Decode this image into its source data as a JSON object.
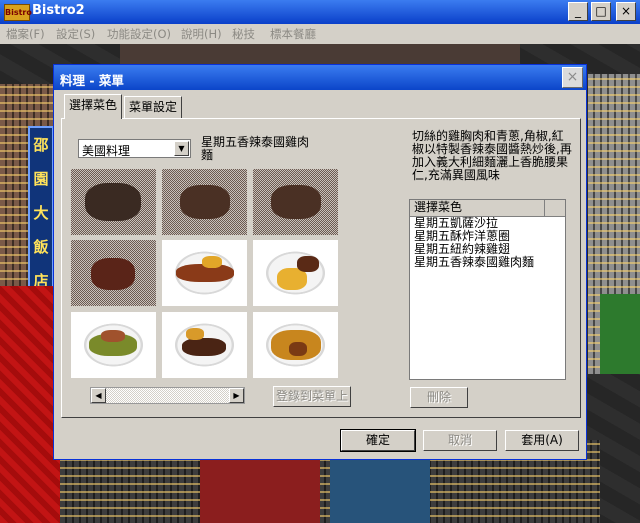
{
  "app": {
    "title": "Bistro2",
    "icon_text": "Bistro",
    "window_buttons": {
      "minimize": "_",
      "maximize": "□",
      "close": "×"
    },
    "menu": [
      "檔案(F)",
      "設定(S)",
      "功能設定(O)",
      "說明(H)",
      "秘技",
      "標本餐廳"
    ]
  },
  "background": {
    "sign_chars": [
      "邵",
      "園",
      "大",
      "飯",
      "店"
    ]
  },
  "dialog": {
    "title": "料理 - 菜單",
    "close_glyph": "×",
    "tabs": [
      {
        "label": "選擇菜色",
        "active": true
      },
      {
        "label": "菜單設定",
        "active": false
      }
    ],
    "category": {
      "selected": "美國料理",
      "arrow": "▼"
    },
    "selected_dish": "星期五香辣泰國雞肉麵",
    "description": "切絲的雞胸肉和青蔥,角椒,紅椒以特製香辣泰國醬熱炒後,再加入義大利細麵灑上香脆腰果仁,充滿異國風味",
    "thumbnails": [
      {
        "name": "dish-1",
        "enabled": false
      },
      {
        "name": "dish-2",
        "enabled": false
      },
      {
        "name": "dish-3",
        "enabled": false
      },
      {
        "name": "dish-4",
        "enabled": false
      },
      {
        "name": "dish-5",
        "enabled": true
      },
      {
        "name": "dish-6",
        "enabled": true
      },
      {
        "name": "dish-7",
        "enabled": true
      },
      {
        "name": "dish-8",
        "enabled": true
      },
      {
        "name": "dish-9",
        "enabled": true
      }
    ],
    "scrollbar": {
      "left_arrow": "◀",
      "right_arrow": "▶"
    },
    "add_to_menu_button": "登錄到菜單上",
    "list": {
      "header": "選擇菜色",
      "items": [
        "星期五凱薩沙拉",
        "星期五酥炸洋蔥圈",
        "星期五紐約辣雞翅",
        "星期五香辣泰國雞肉麵"
      ]
    },
    "delete_button": "刪除",
    "footer": {
      "ok": "確定",
      "cancel": "取消",
      "apply": "套用(A)"
    }
  },
  "colors": {
    "titlebar": "#0a3fc9",
    "dialog_face": "#d4d0c8",
    "disabled_text": "#8c8a84",
    "carpet": "#c21414"
  }
}
